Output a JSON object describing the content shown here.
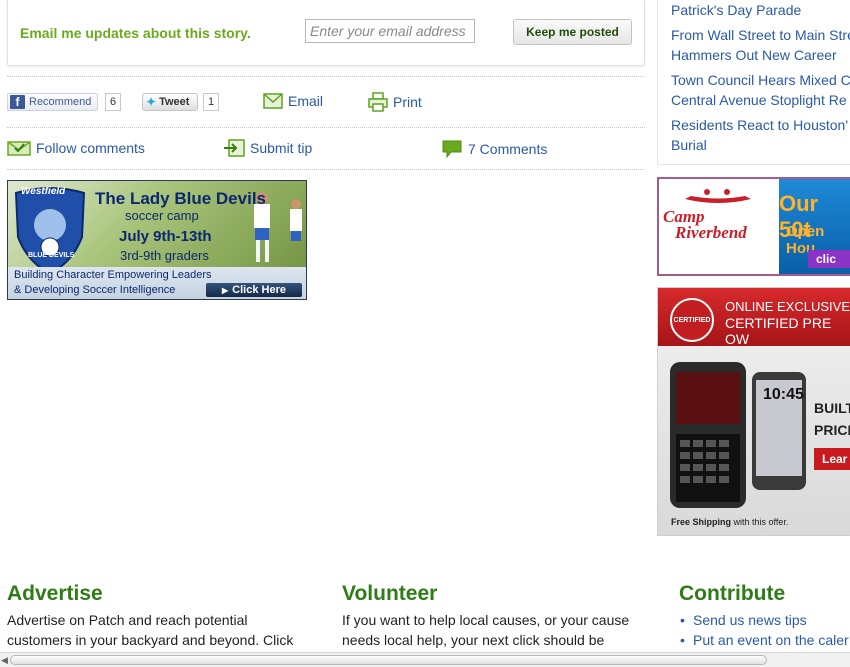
{
  "email_signup": {
    "label": "Email me updates about this story.",
    "placeholder": "Enter your email address",
    "value": "",
    "button_label": "Keep me posted"
  },
  "share": {
    "recommend_label": "Recommend",
    "recommend_count": "6",
    "tweet_label": "Tweet",
    "tweet_count": "1",
    "email_label": "Email",
    "print_label": "Print"
  },
  "actions": {
    "follow_label": "Follow comments",
    "submit_tip_label": "Submit tip",
    "comments_label": "7 Comments"
  },
  "ad_soccer": {
    "logo_top": "Westfield",
    "logo_bottom": "BLUE DEVILS",
    "title": "The Lady Blue Devils",
    "subtitle": "soccer camp",
    "dates": "July 9th-13th",
    "grades": "3rd-9th graders",
    "tagline_1": "Building Character Empowering Leaders",
    "tagline_2": "& Developing Soccer Intelligence",
    "cta": "Click Here"
  },
  "related": {
    "links": [
      "Patrick's Day Parade",
      "From Wall Street to Main Stre",
      "Hammers Out New Career",
      "Town Council Hears Mixed C",
      "Central Avenue Stoplight Re",
      "Residents React to Houston'",
      "Burial"
    ]
  },
  "ad_camp": {
    "brand_1": "Camp",
    "brand_2": "Riverbend",
    "headline": "Our 50t",
    "subline": "Open Hou",
    "cta": "clic"
  },
  "ad_phone": {
    "seal_text": "CERTIFIED",
    "line_1": "ONLINE EXCLUSIVE",
    "line_2": "CERTIFIED PRE OW",
    "phone_time": "10:45",
    "built": "BUILT",
    "price": "PRICE",
    "learn": "Lear",
    "shipping_bold": "Free Shipping",
    "shipping_rest": " with this offer."
  },
  "footer": {
    "advertise": {
      "title": "Advertise",
      "line_1": "Advertise on Patch and reach potential",
      "line_2": "customers in your backyard and beyond. Click"
    },
    "volunteer": {
      "title": "Volunteer",
      "line_1": "If you want to help local causes, or your cause",
      "line_2": "needs local help, your next click should be"
    },
    "contribute": {
      "title": "Contribute",
      "items": [
        "Send us news tips",
        "Put an event on the caler"
      ]
    }
  },
  "colors": {
    "green_label": "#6aaa1e",
    "link_blue": "#2a5aa8",
    "footer_green": "#2e7d14",
    "facebook": "#3b5998"
  }
}
